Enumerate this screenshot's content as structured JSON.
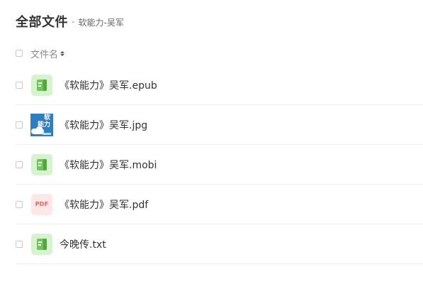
{
  "header": {
    "title": "全部文件",
    "breadcrumb_separator": "▸",
    "current_folder": "软能力-吴军"
  },
  "list_header": {
    "name_column": "文件名"
  },
  "files": [
    {
      "name": "《软能力》吴军.epub",
      "icon": "ebook-icon"
    },
    {
      "name": "《软能力》吴军.jpg",
      "icon": "image-thumbnail",
      "thumb_text_1": "软",
      "thumb_text_2": "能力"
    },
    {
      "name": "《软能力》吴军.mobi",
      "icon": "ebook-icon"
    },
    {
      "name": "《软能力》吴军.pdf",
      "icon": "pdf-icon",
      "icon_label": "PDF"
    },
    {
      "name": "今晚传.txt",
      "icon": "ebook-icon"
    }
  ],
  "colors": {
    "book_icon_green": "#6fc45c",
    "pdf_icon_red": "#ef5c5c",
    "thumbnail_blue": "#2f7ec1"
  }
}
